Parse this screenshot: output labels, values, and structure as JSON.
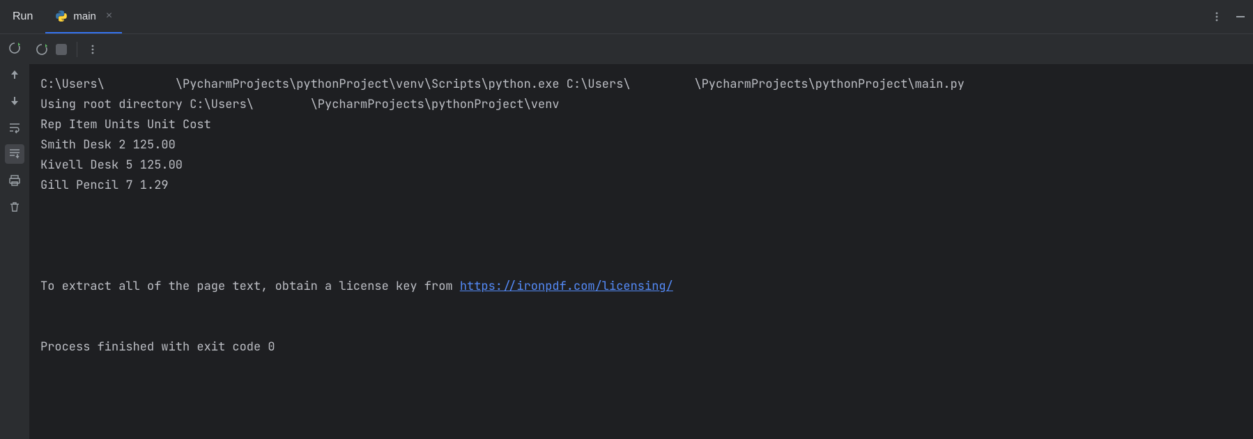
{
  "topbar": {
    "run_label": "Run",
    "tab_name": "main",
    "tab_close": "×"
  },
  "gutter": {
    "rerun": "rerun",
    "up": "up",
    "down": "down",
    "softwrap": "softwrap",
    "scrollend": "scrollend",
    "print": "print",
    "trash": "trash"
  },
  "console": {
    "lines": {
      "l0": "C:\\Users\\          \\PycharmProjects\\pythonProject\\venv\\Scripts\\python.exe C:\\Users\\         \\PycharmProjects\\pythonProject\\main.py ",
      "l1": "Using root directory C:\\Users\\        \\PycharmProjects\\pythonProject\\venv",
      "l2": "Rep Item Units Unit Cost",
      "l3": "Smith Desk 2 125.00",
      "l4": "Kivell Desk 5 125.00",
      "l5": "Gill Pencil 7 1.29",
      "license_prefix": "To extract all of the page text, obtain a license key from ",
      "license_link": "https://ironpdf.com/licensing/",
      "exit": "Process finished with exit code 0"
    }
  }
}
